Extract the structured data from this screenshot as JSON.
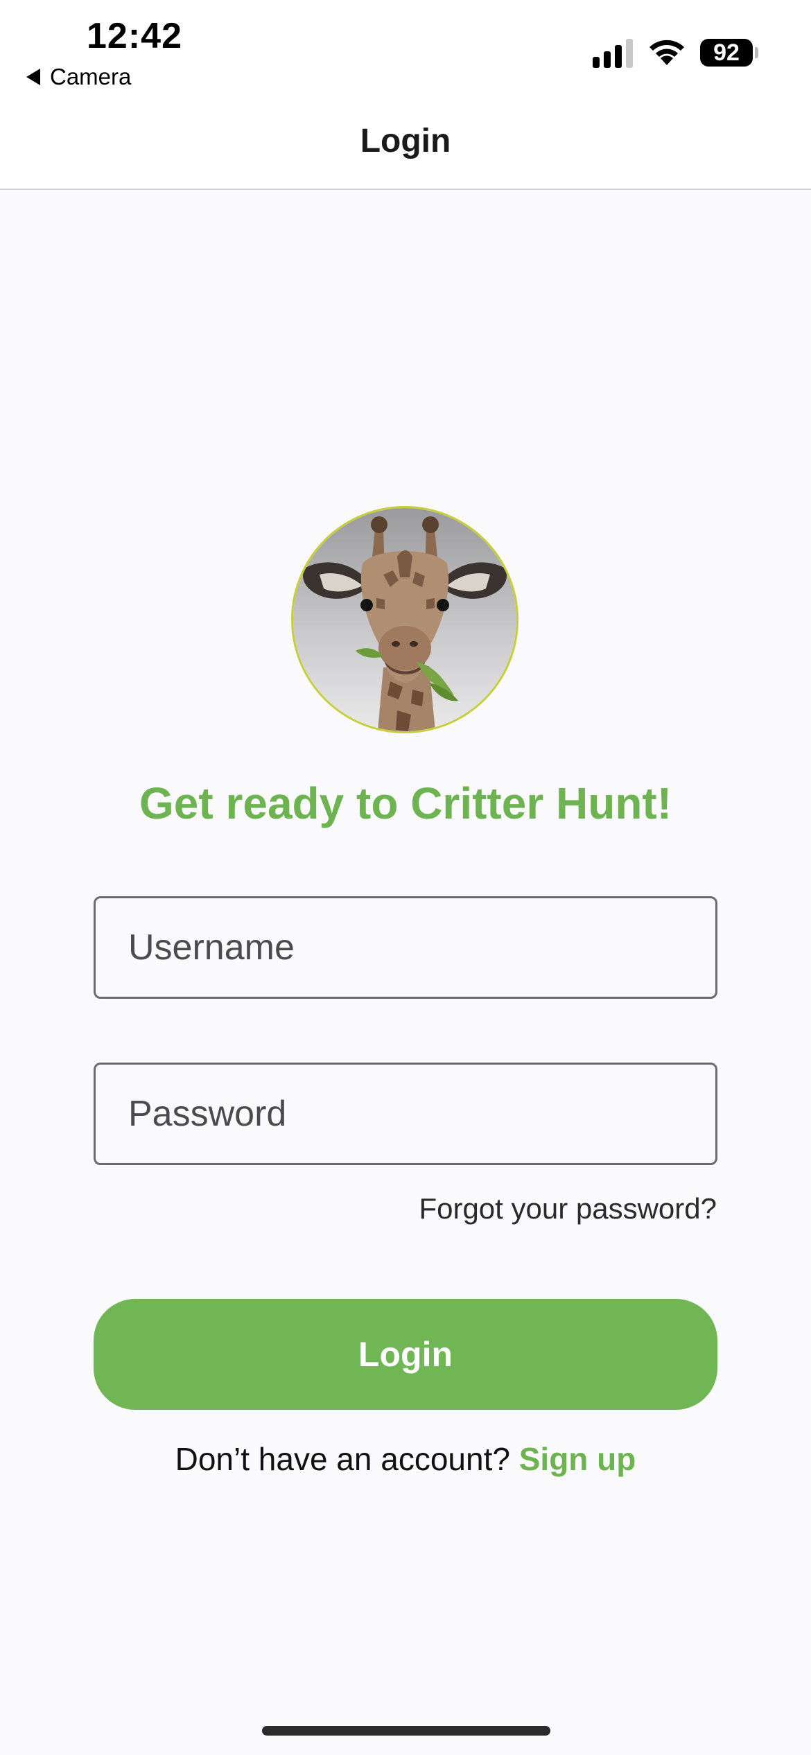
{
  "status_bar": {
    "time": "12:42",
    "back_label": "Camera",
    "battery": "92"
  },
  "nav": {
    "title": "Login"
  },
  "hero": {
    "avatar_icon": "giraffe-avatar",
    "headline": "Get ready to Critter Hunt!"
  },
  "form": {
    "username_placeholder": "Username",
    "password_placeholder": "Password",
    "forgot_label": "Forgot your password?",
    "login_label": "Login"
  },
  "footer": {
    "signup_prompt": "Don’t have an account?",
    "signup_link": "Sign up"
  },
  "colors": {
    "accent": "#6db352",
    "button": "#70b654",
    "avatar_ring": "#c6cf3a"
  }
}
